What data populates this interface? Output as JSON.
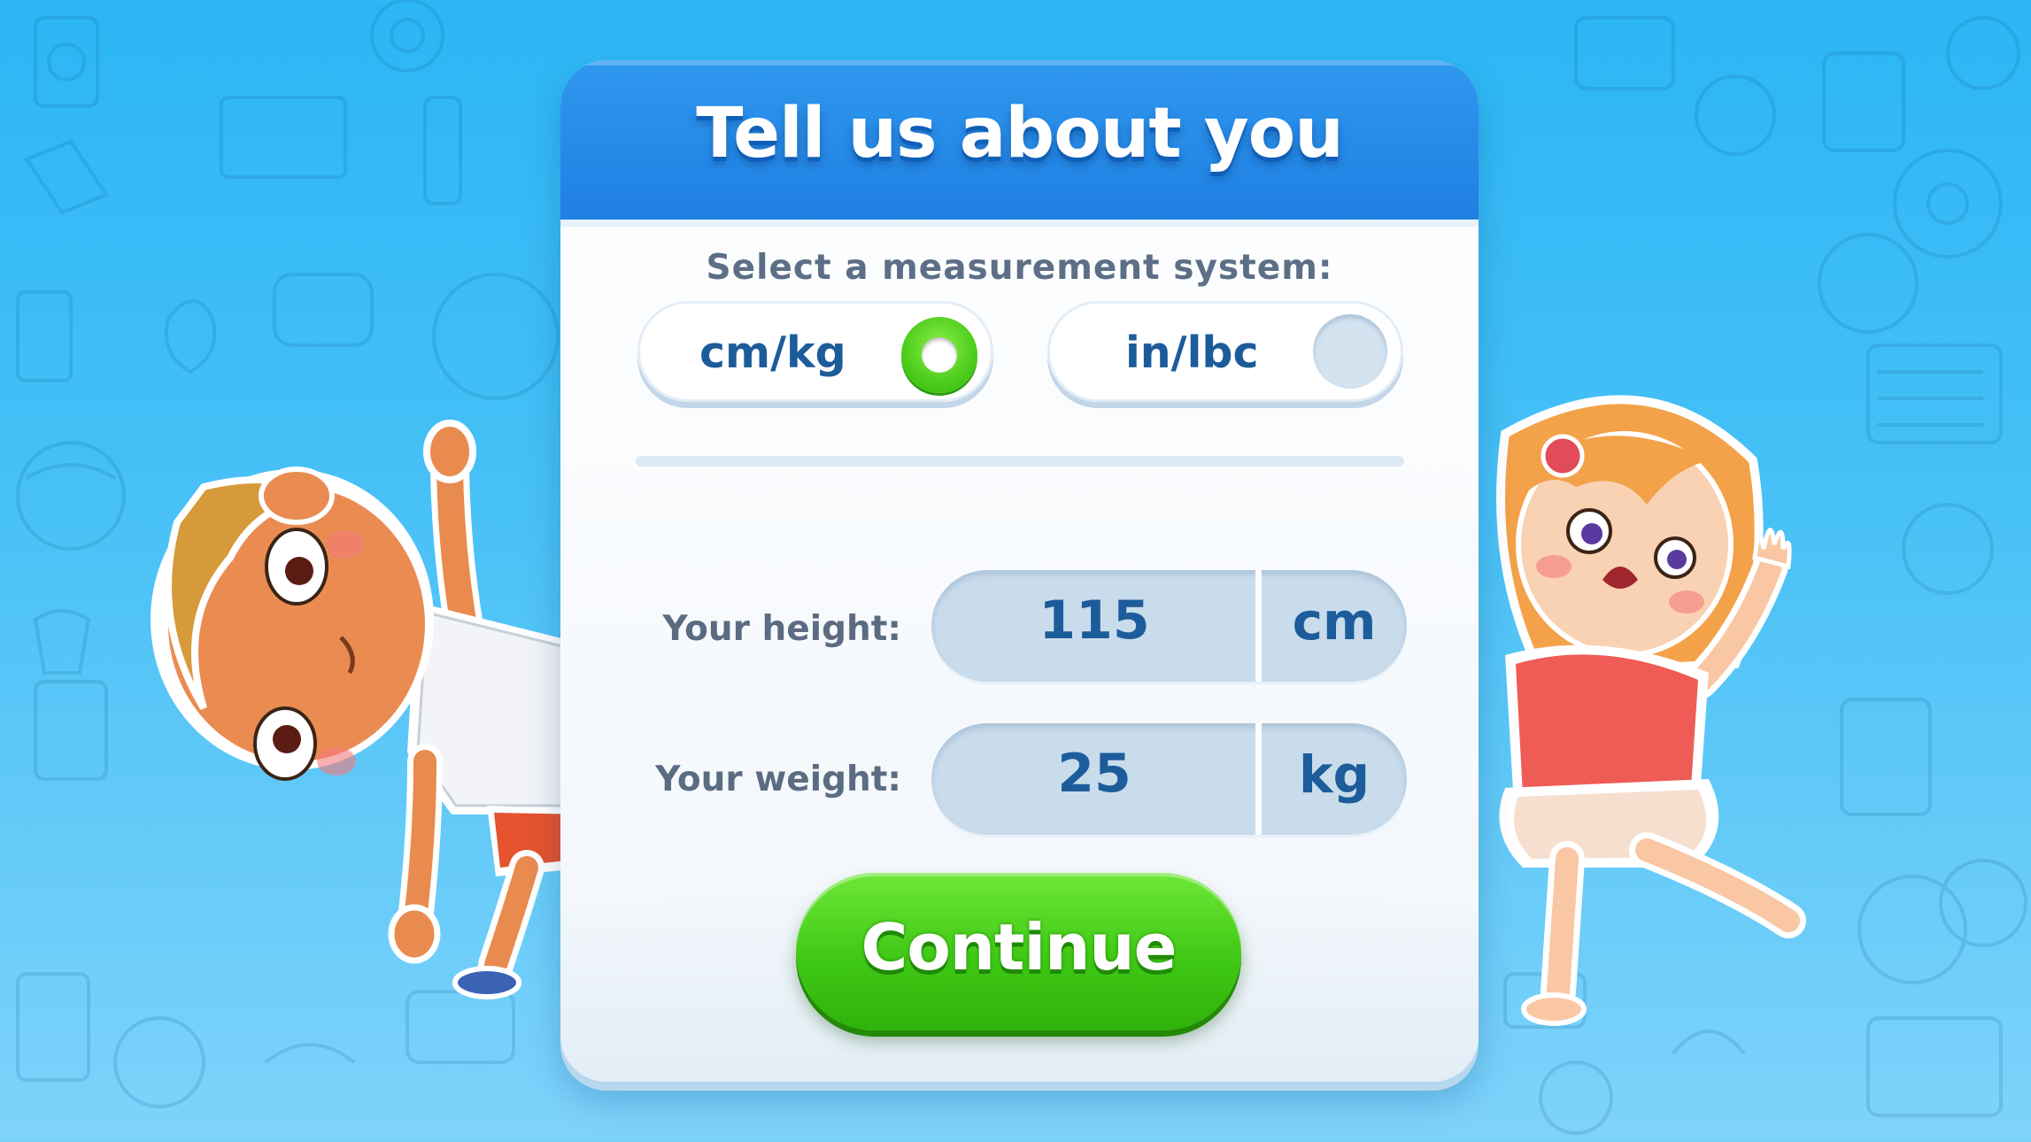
{
  "dialog": {
    "title": "Tell us about you",
    "subtitle": "Select a measurement system:"
  },
  "units": {
    "options": [
      {
        "label": "cm/kg",
        "selected": true
      },
      {
        "label": "in/lbc",
        "selected": false
      }
    ]
  },
  "measurements": {
    "height": {
      "label": "Your height:",
      "value": "115",
      "unit": "cm"
    },
    "weight": {
      "label": "Your weight:",
      "value": "25",
      "unit": "kg"
    }
  },
  "actions": {
    "continue_label": "Continue"
  },
  "colors": {
    "header_blue": "#1f7fe2",
    "continue_green": "#3fc815",
    "selected_radio": "#4ccc1c",
    "text_blue": "#1d5c9a",
    "background_sky": "#48c1f6"
  },
  "icons": {
    "selected_radio": "radio-selected-icon",
    "unselected_radio": "radio-unselected-icon"
  }
}
